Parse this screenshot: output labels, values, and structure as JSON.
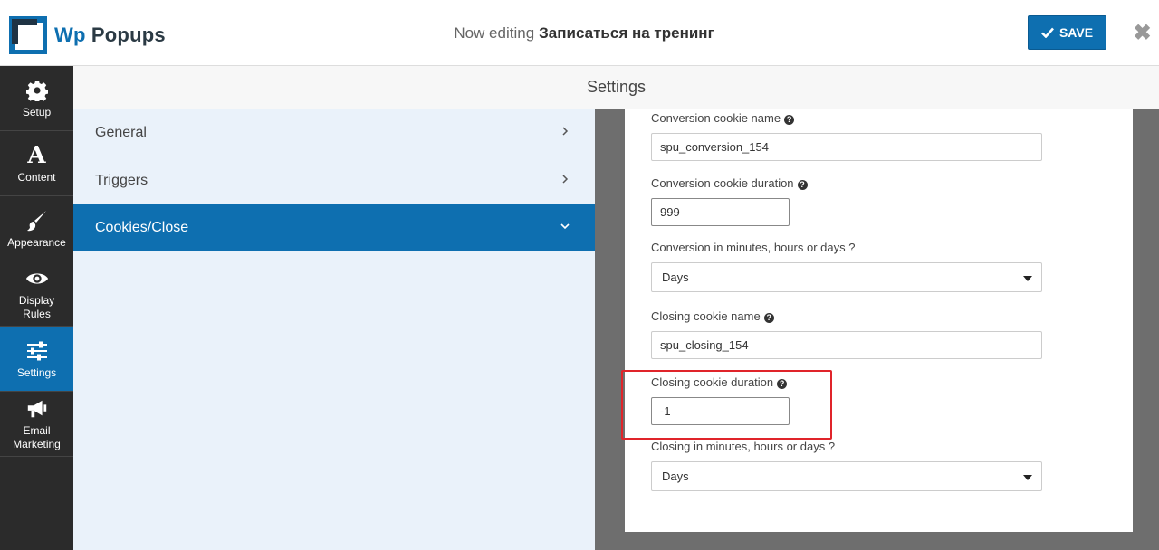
{
  "header": {
    "logo_wp": "Wp",
    "logo_popups": "Popups",
    "editing_prefix": "Now editing",
    "editing_name": "Записаться на тренинг",
    "save_label": "SAVE",
    "close_glyph": "✖"
  },
  "nav": {
    "items": [
      {
        "label": "Setup",
        "icon": "gear-icon"
      },
      {
        "label": "Content",
        "icon": "font-icon"
      },
      {
        "label": "Appearance",
        "icon": "paintbrush-icon"
      },
      {
        "label": "Display Rules",
        "icon": "eye-icon"
      },
      {
        "label": "Settings",
        "icon": "sliders-icon",
        "active": true
      },
      {
        "label": "Email Marketing",
        "icon": "megaphone-icon"
      }
    ]
  },
  "settings": {
    "title": "Settings",
    "sections": [
      {
        "label": "General",
        "active": false
      },
      {
        "label": "Triggers",
        "active": false
      },
      {
        "label": "Cookies/Close",
        "active": true
      }
    ]
  },
  "form": {
    "conversion_cookie_name_label": "Conversion cookie name",
    "conversion_cookie_name_value": "spu_conversion_154",
    "conversion_cookie_duration_label": "Conversion cookie duration",
    "conversion_cookie_duration_value": "999",
    "conversion_unit_label": "Conversion in minutes, hours or days ?",
    "conversion_unit_value": "Days",
    "closing_cookie_name_label": "Closing cookie name",
    "closing_cookie_name_value": "spu_closing_154",
    "closing_cookie_duration_label": "Closing cookie duration",
    "closing_cookie_duration_value": "-1",
    "closing_unit_label": "Closing in minutes, hours or days ?",
    "closing_unit_value": "Days"
  },
  "colors": {
    "accent": "#0e6fb0",
    "sidebar_bg": "#2b2b2b",
    "highlight": "#e0242a"
  }
}
